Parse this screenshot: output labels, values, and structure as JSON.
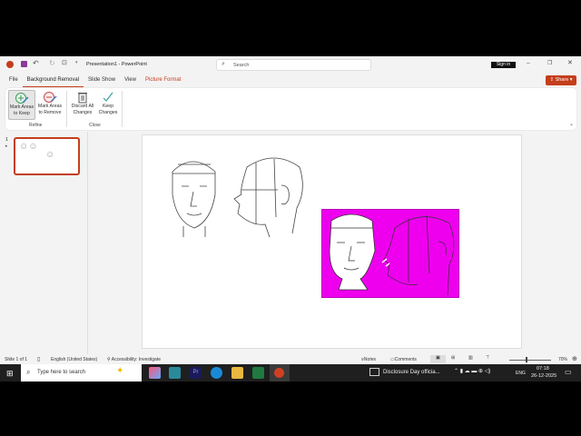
{
  "title_bar": {
    "doc_title": "Presentation1 - PowerPoint",
    "search_placeholder": "Search",
    "sign_in": "Sign in"
  },
  "tabs": [
    "File",
    "Background Removal",
    "Slide Show",
    "View",
    "Picture Format"
  ],
  "share_label": "Share",
  "ribbon": {
    "refine": {
      "label": "Refine",
      "keep": "Mark Areas to Keep",
      "remove": "Mark Areas to Remove"
    },
    "close": {
      "label": "Close",
      "discard": "Discard All Changes",
      "keep_changes": "Keep Changes"
    }
  },
  "thumbnail": {
    "number": "1",
    "star": "★"
  },
  "status": {
    "slide": "Slide 1 of 1",
    "language": "English (United States)",
    "accessibility": "Accessibility: Investigate",
    "notes": "Notes",
    "comments": "Comments",
    "zoom": "70%"
  },
  "taskbar": {
    "search_placeholder": "Type here to search",
    "news": "Disclosure Day officia...",
    "lang": "ENG",
    "time": "07:18",
    "date": "26-12-2025"
  },
  "colors": {
    "accent": "#c43e1c",
    "removal_mask": "#ee00ee"
  }
}
